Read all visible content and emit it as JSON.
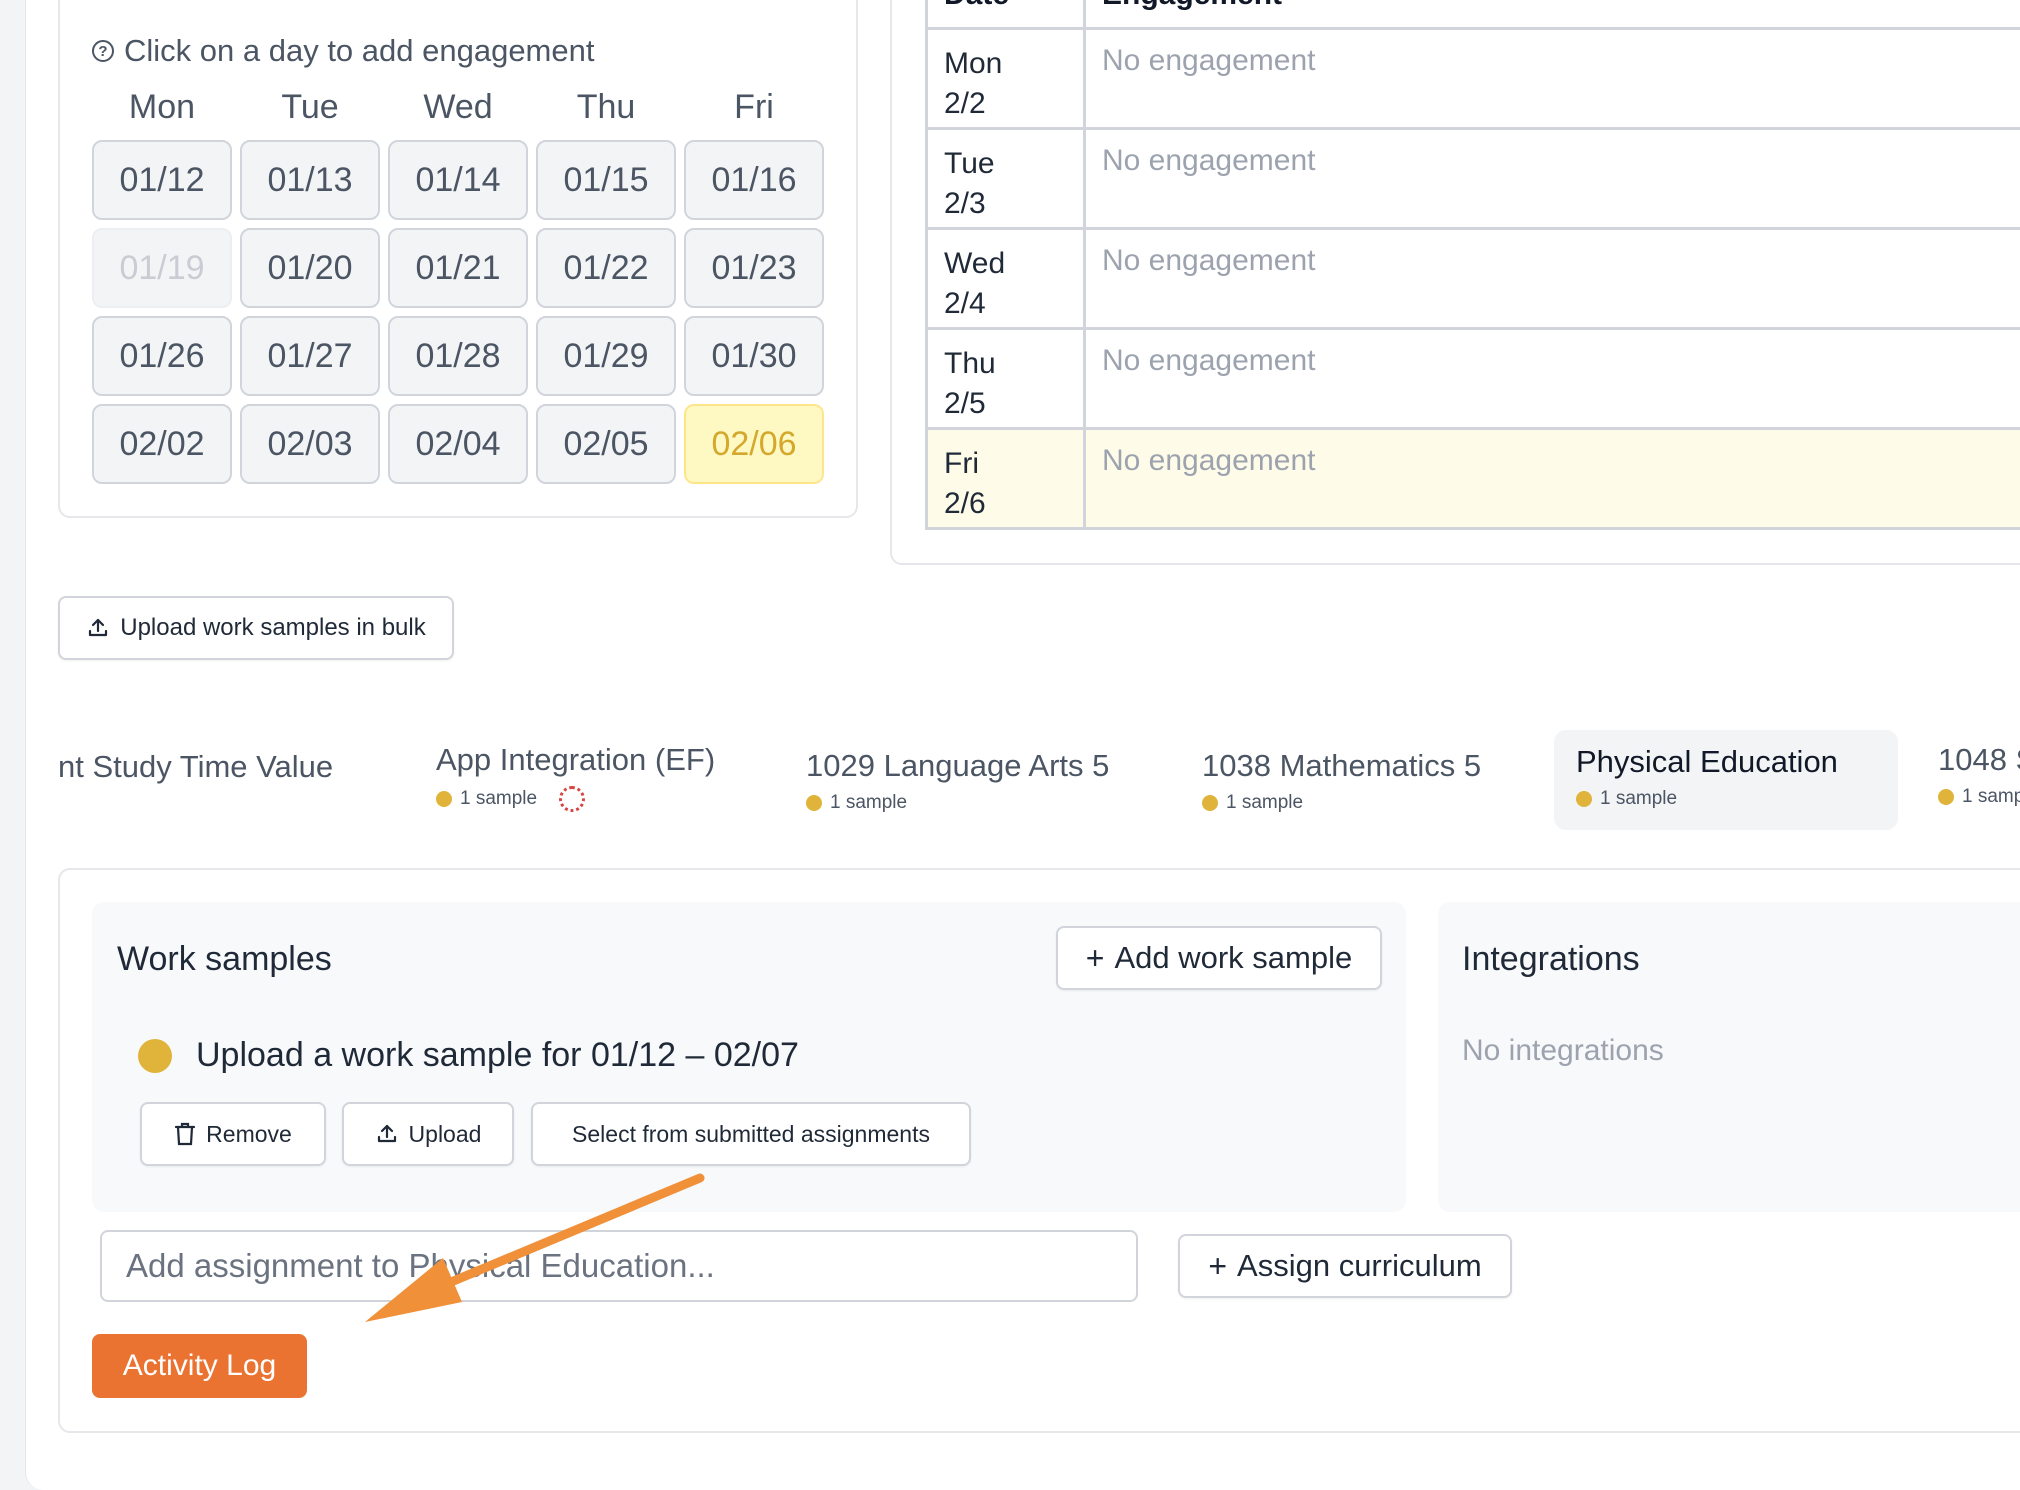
{
  "calendar": {
    "hint": "Click on a day to add engagement",
    "weekdays": [
      "Mon",
      "Tue",
      "Wed",
      "Thu",
      "Fri"
    ],
    "days": [
      [
        "01/12",
        "01/13",
        "01/14",
        "01/15",
        "01/16"
      ],
      [
        "01/19",
        "01/20",
        "01/21",
        "01/22",
        "01/23"
      ],
      [
        "01/26",
        "01/27",
        "01/28",
        "01/29",
        "01/30"
      ],
      [
        "02/02",
        "02/03",
        "02/04",
        "02/05",
        "02/06"
      ]
    ],
    "disabled_day": "01/19",
    "today": "02/06"
  },
  "engagement": {
    "headers": [
      "Date",
      "Engagement"
    ],
    "rows": [
      {
        "day": "Mon",
        "date": "2/2",
        "value": "No engagement"
      },
      {
        "day": "Tue",
        "date": "2/3",
        "value": "No engagement"
      },
      {
        "day": "Wed",
        "date": "2/4",
        "value": "No engagement"
      },
      {
        "day": "Thu",
        "date": "2/5",
        "value": "No engagement"
      },
      {
        "day": "Fri",
        "date": "2/6",
        "value": "No engagement"
      }
    ]
  },
  "bulk_upload_label": "Upload work samples in bulk",
  "tabs": [
    {
      "title": "nt Study Time Value",
      "sub": ""
    },
    {
      "title": "App Integration (EF)",
      "sub": "1 sample"
    },
    {
      "title": "1029 Language Arts 5",
      "sub": "1 sample"
    },
    {
      "title": "1038 Mathematics 5",
      "sub": "1 sample"
    },
    {
      "title": "Physical Education",
      "sub": "1 sample"
    },
    {
      "title": "1048 S",
      "sub": "1 samp"
    }
  ],
  "work_samples": {
    "title": "Work samples",
    "add_label": "Add work sample",
    "item_text": "Upload a work sample for 01/12 – 02/07",
    "remove_label": "Remove",
    "upload_label": "Upload",
    "select_label": "Select from submitted assignments"
  },
  "integrations": {
    "title": "Integrations",
    "empty": "No integrations"
  },
  "assign": {
    "placeholder": "Add assignment to Physical Education...",
    "curriculum_label": "Assign curriculum"
  },
  "activity_log_label": "Activity Log",
  "colors": {
    "accent": "#ea7331",
    "sample_dot": "#e0b43a",
    "today_bg": "#fef9c3"
  }
}
